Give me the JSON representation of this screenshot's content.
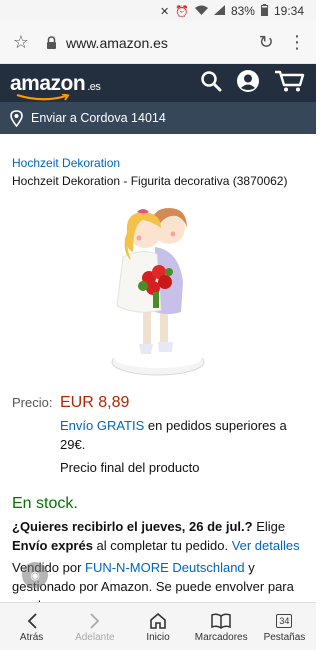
{
  "status_bar": {
    "battery": "83%",
    "time": "19:34"
  },
  "browser": {
    "url": "www.amazon.es"
  },
  "header": {
    "logo_text": "amazon",
    "logo_tld": ".es"
  },
  "deliver": {
    "text": "Enviar a Cordova 14014"
  },
  "product": {
    "brand": "Hochzeit Dekoration",
    "title": "Hochzeit Dekoration - Figurita decorativa (3870062)",
    "price_label": "Precio:",
    "price": "EUR 8,89",
    "shipping_link": "Envío GRATIS",
    "shipping_rest": " en pedidos superiores a 29€.",
    "final_price": "Precio final del producto",
    "stock": "En stock.",
    "delivery_q": "¿Quieres recibirlo el jueves, 26 de jul.?",
    "delivery_elige": " Elige ",
    "delivery_bold": "Envío exprés",
    "delivery_rest": " al completar tu pedido. ",
    "delivery_link": "Ver detalles",
    "sold_by": "Vendido por ",
    "seller_link": "FUN-N-MORE Deutschland",
    "seller_rest": " y gestionado por Amazon. Se puede envolver para regalo."
  },
  "bottom_nav": {
    "back": "Atrás",
    "forward": "Adelante",
    "home": "Inicio",
    "bookmarks": "Marcadores",
    "tabs": "Pestañas",
    "tabs_count": "34"
  },
  "colors": {
    "header_bg": "#232f3e",
    "deliver_bg": "#37475a",
    "link": "#0066c0",
    "price": "#b12704",
    "stock": "#007600",
    "smile": "#ff9900"
  }
}
